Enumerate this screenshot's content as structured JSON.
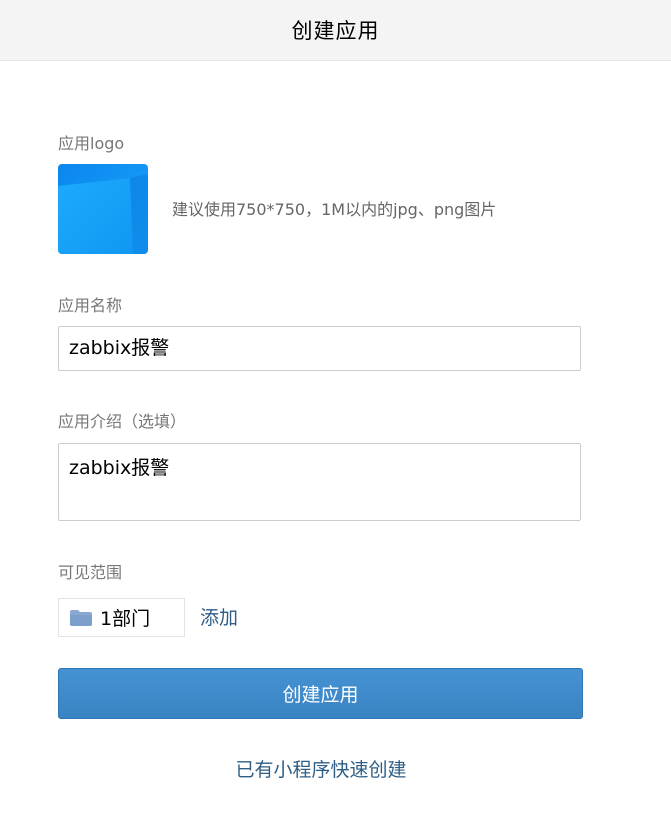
{
  "header": {
    "title": "创建应用"
  },
  "logo_section": {
    "label": "应用logo",
    "hint": "建议使用750*750，1M以内的jpg、png图片",
    "icon": "app-logo-placeholder"
  },
  "name_section": {
    "label": "应用名称",
    "value": "zabbix报警"
  },
  "desc_section": {
    "label": "应用介绍（选填）",
    "value": "zabbix报警"
  },
  "scope_section": {
    "label": "可见范围",
    "chip_icon": "folder-icon",
    "chip_text": "1部门",
    "add_label": "添加"
  },
  "actions": {
    "create_label": "创建应用",
    "quick_create_label": "已有小程序快速创建"
  },
  "colors": {
    "primary_button": "#3a83c3",
    "link": "#2e5e86",
    "logo_blue": "#1a9cf5"
  }
}
